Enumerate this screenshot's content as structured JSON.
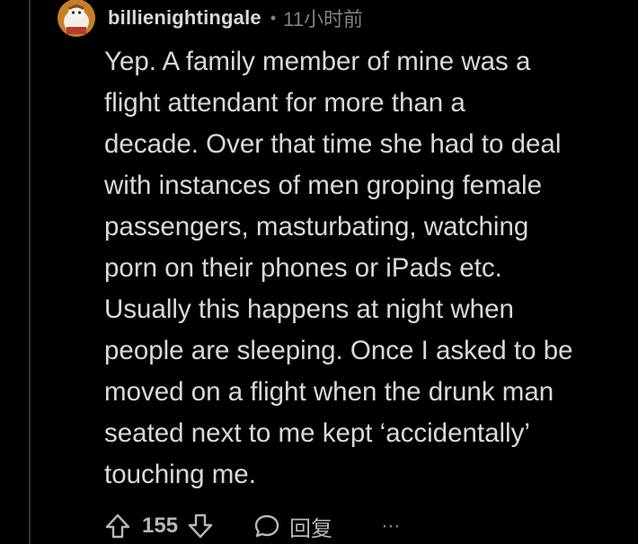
{
  "comment": {
    "username": "billienightingale",
    "separator": "•",
    "time": "11小时前",
    "body": "Yep. A family member of mine was a\nflight attendant for more than a\ndecade. Over that time she had to deal\nwith instances of men groping female\npassengers, masturbating, watching\nporn on their phones or iPads etc.\nUsually this happens at night when\npeople are sleeping. Once I asked to be\nmoved on a flight when the drunk man\nseated next to me kept ‘accidentally’\ntouching me.",
    "upvote_icon": "arrow-up-icon",
    "vote_count": "155",
    "downvote_icon": "arrow-down-icon",
    "reply_icon": "chat-bubble-icon",
    "reply_label": "回复",
    "more_icon": "ellipsis-icon",
    "more_label": "···"
  },
  "colors": {
    "background": "#000000",
    "text": "#d7dadc",
    "meta": "#818384",
    "avatar_bg": "#d08a2d"
  }
}
